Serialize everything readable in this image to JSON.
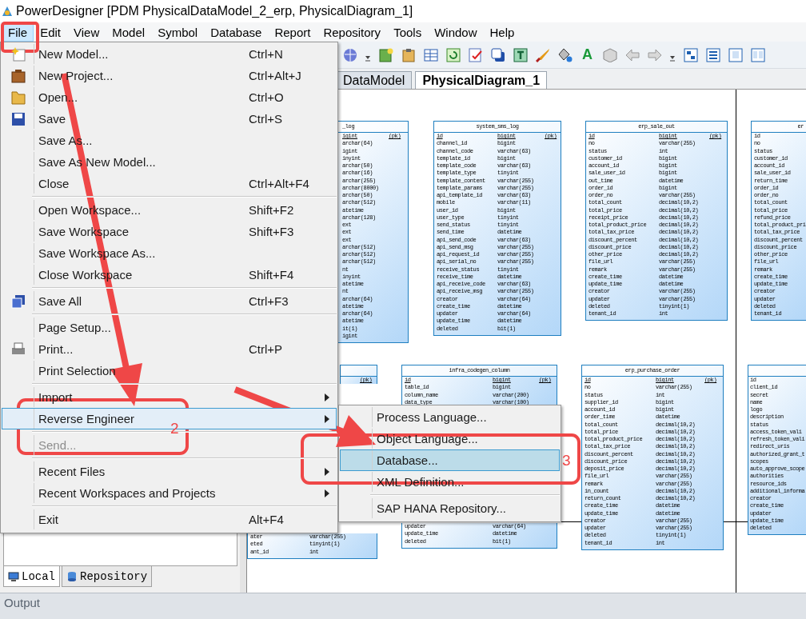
{
  "window": {
    "title": "PowerDesigner [PDM PhysicalDataModel_2_erp, PhysicalDiagram_1]"
  },
  "menubar": [
    {
      "label": "File",
      "selected": true
    },
    {
      "label": "Edit",
      "selected": false
    },
    {
      "label": "View",
      "selected": false
    },
    {
      "label": "Model",
      "selected": false
    },
    {
      "label": "Symbol",
      "selected": false
    },
    {
      "label": "Database",
      "selected": false
    },
    {
      "label": "Report",
      "selected": false
    },
    {
      "label": "Repository",
      "selected": false
    },
    {
      "label": "Tools",
      "selected": false
    },
    {
      "label": "Window",
      "selected": false
    },
    {
      "label": "Help",
      "selected": false
    }
  ],
  "toolbar": {
    "letter_icon": "A"
  },
  "diagram_tabs": [
    {
      "label": "DataModel",
      "selected": false
    },
    {
      "label": "PhysicalDiagram_1",
      "selected": true
    }
  ],
  "diagram": {
    "tables": [
      {
        "title": "_log",
        "columns": [
          {
            "type": "igint",
            "key": "(pk)"
          },
          {
            "type": "archar(64)"
          },
          {
            "type": "igint"
          },
          {
            "type": "inyint"
          },
          {
            "type": "archar(50)"
          },
          {
            "type": "archar(16)"
          },
          {
            "type": "archar(255)"
          },
          {
            "type": "archar(8000)"
          },
          {
            "type": "archar(50)"
          },
          {
            "type": "archar(512)"
          },
          {
            "type": "atetime"
          },
          {
            "type": "archar(128)"
          },
          {
            "type": "ext"
          },
          {
            "type": "ext"
          },
          {
            "type": "ext"
          },
          {
            "type": "archar(512)"
          },
          {
            "type": "archar(512)"
          },
          {
            "type": "archar(512)"
          },
          {
            "type": "nt"
          },
          {
            "type": "inyint"
          },
          {
            "type": "atetime"
          },
          {
            "type": "nt"
          },
          {
            "type": "archar(64)"
          },
          {
            "type": "atetime"
          },
          {
            "type": "archar(64)"
          },
          {
            "type": "atetime"
          },
          {
            "type": "it(1)"
          },
          {
            "type": "igint"
          }
        ]
      },
      {
        "title": "system_sms_log",
        "columns": [
          {
            "name": "id",
            "type": "bigint",
            "key": "(pk)"
          },
          {
            "name": "channel_id",
            "type": "bigint"
          },
          {
            "name": "channel_code",
            "type": "varchar(63)"
          },
          {
            "name": "template_id",
            "type": "bigint"
          },
          {
            "name": "template_code",
            "type": "varchar(63)"
          },
          {
            "name": "template_type",
            "type": "tinyint"
          },
          {
            "name": "template_content",
            "type": "varchar(255)"
          },
          {
            "name": "template_params",
            "type": "varchar(255)"
          },
          {
            "name": "api_template_id",
            "type": "varchar(63)"
          },
          {
            "name": "mobile",
            "type": "varchar(11)"
          },
          {
            "name": "user_id",
            "type": "bigint"
          },
          {
            "name": "user_type",
            "type": "tinyint"
          },
          {
            "name": "send_status",
            "type": "tinyint"
          },
          {
            "name": "send_time",
            "type": "datetime"
          },
          {
            "name": "api_send_code",
            "type": "varchar(63)"
          },
          {
            "name": "api_send_msg",
            "type": "varchar(255)"
          },
          {
            "name": "api_request_id",
            "type": "varchar(255)"
          },
          {
            "name": "api_serial_no",
            "type": "varchar(255)"
          },
          {
            "name": "receive_status",
            "type": "tinyint"
          },
          {
            "name": "receive_time",
            "type": "datetime"
          },
          {
            "name": "api_receive_code",
            "type": "varchar(63)"
          },
          {
            "name": "api_receive_msg",
            "type": "varchar(255)"
          },
          {
            "name": "creator",
            "type": "varchar(64)"
          },
          {
            "name": "create_time",
            "type": "datetime"
          },
          {
            "name": "updater",
            "type": "varchar(64)"
          },
          {
            "name": "update_time",
            "type": "datetime"
          },
          {
            "name": "deleted",
            "type": "bit(1)"
          }
        ]
      },
      {
        "title": "erp_sale_out",
        "columns": [
          {
            "name": "id",
            "type": "bigint",
            "key": "(pk)"
          },
          {
            "name": "no",
            "type": "varchar(255)"
          },
          {
            "name": "status",
            "type": "int"
          },
          {
            "name": "customer_id",
            "type": "bigint"
          },
          {
            "name": "account_id",
            "type": "bigint"
          },
          {
            "name": "sale_user_id",
            "type": "bigint"
          },
          {
            "name": "out_time",
            "type": "datetime"
          },
          {
            "name": "order_id",
            "type": "bigint"
          },
          {
            "name": "order_no",
            "type": "varchar(255)"
          },
          {
            "name": "total_count",
            "type": "decimal(10,2)"
          },
          {
            "name": "total_price",
            "type": "decimal(10,2)"
          },
          {
            "name": "receipt_price",
            "type": "decimal(10,2)"
          },
          {
            "name": "total_product_price",
            "type": "decimal(10,2)"
          },
          {
            "name": "total_tax_price",
            "type": "decimal(10,2)"
          },
          {
            "name": "discount_percent",
            "type": "decimal(10,2)"
          },
          {
            "name": "discount_price",
            "type": "decimal(10,2)"
          },
          {
            "name": "other_price",
            "type": "decimal(10,2)"
          },
          {
            "name": "file_url",
            "type": "varchar(255)"
          },
          {
            "name": "remark",
            "type": "varchar(255)"
          },
          {
            "name": "create_time",
            "type": "datetime"
          },
          {
            "name": "update_time",
            "type": "datetime"
          },
          {
            "name": "creator",
            "type": "varchar(255)"
          },
          {
            "name": "updater",
            "type": "varchar(255)"
          },
          {
            "name": "deleted",
            "type": "tinyint(1)"
          },
          {
            "name": "tenant_id",
            "type": "int"
          }
        ]
      },
      {
        "title": "er",
        "columns": [
          {
            "name": "id"
          },
          {
            "name": "no"
          },
          {
            "name": "status"
          },
          {
            "name": "customer_id"
          },
          {
            "name": "account_id"
          },
          {
            "name": "sale_user_id"
          },
          {
            "name": "return_time"
          },
          {
            "name": "order_id"
          },
          {
            "name": "order_no"
          },
          {
            "name": "total_count"
          },
          {
            "name": "total_price"
          },
          {
            "name": "refund_price"
          },
          {
            "name": "total_product_pri"
          },
          {
            "name": "total_tax_price"
          },
          {
            "name": "discount_percent"
          },
          {
            "name": "discount_price"
          },
          {
            "name": "other_price"
          },
          {
            "name": "file_url"
          },
          {
            "name": "remark"
          },
          {
            "name": "create_time"
          },
          {
            "name": "update_time"
          },
          {
            "name": "creator"
          },
          {
            "name": "updater"
          },
          {
            "name": "deleted"
          },
          {
            "name": "tenant_id"
          }
        ]
      },
      {
        "columns": [
          {
            "key": "(pk)"
          }
        ],
        "columns_below_menu": [
          {
            "name": "ater",
            "type": "varchar(255)"
          },
          {
            "name": "eted",
            "type": "tinyint(1)"
          },
          {
            "name": "ant_id",
            "type": "int"
          }
        ]
      },
      {
        "title": "infra_codegen_column",
        "columns": [
          {
            "name": "id",
            "type": "bigint",
            "key": "(pk)"
          },
          {
            "name": "table_id",
            "type": "bigint"
          },
          {
            "name": "column_name",
            "type": "varchar(200)"
          },
          {
            "name": "data_type",
            "type": "varchar(100)"
          }
        ],
        "columns_below_menu": [
          {
            "name": "updater",
            "type": "varchar(64)"
          },
          {
            "name": "update_time",
            "type": "datetime"
          },
          {
            "name": "deleted",
            "type": "bit(1)"
          }
        ]
      },
      {
        "title": "erp_purchase_order",
        "columns": [
          {
            "name": "id",
            "type": "bigint",
            "key": "(pk)"
          },
          {
            "name": "no",
            "type": "varchar(255)"
          },
          {
            "name": "status",
            "type": "int"
          },
          {
            "name": "supplier_id",
            "type": "bigint"
          },
          {
            "name": "account_id",
            "type": "bigint"
          },
          {
            "name": "order_time",
            "type": "datetime"
          },
          {
            "name": "total_count",
            "type": "decimal(10,2)"
          },
          {
            "name": "total_price",
            "type": "decimal(10,2)"
          },
          {
            "name": "total_product_price",
            "type": "decimal(10,2)"
          },
          {
            "name": "total_tax_price",
            "type": "decimal(10,2)"
          },
          {
            "name": "discount_percent",
            "type": "decimal(10,2)"
          },
          {
            "name": "discount_price",
            "type": "decimal(10,2)"
          },
          {
            "name": "deposit_price",
            "type": "decimal(10,2)"
          },
          {
            "name": "file_url",
            "type": "varchar(255)"
          },
          {
            "name": "remark",
            "type": "varchar(255)"
          },
          {
            "name": "in_count",
            "type": "decimal(10,2)"
          },
          {
            "name": "return_count",
            "type": "decimal(10,2)"
          },
          {
            "name": "create_time",
            "type": "datetime"
          },
          {
            "name": "update_time",
            "type": "datetime"
          },
          {
            "name": "creator",
            "type": "varchar(255)"
          },
          {
            "name": "updater",
            "type": "varchar(255)"
          },
          {
            "name": "deleted",
            "type": "tinyint(1)"
          },
          {
            "name": "tenant_id",
            "type": "int"
          }
        ]
      },
      {
        "columns": [
          {
            "name": "id"
          },
          {
            "name": "client_id"
          },
          {
            "name": "secret"
          },
          {
            "name": "name"
          },
          {
            "name": "logo"
          },
          {
            "name": "description"
          },
          {
            "name": "status"
          },
          {
            "name": "access_token_vali"
          },
          {
            "name": "refresh_token_vali"
          },
          {
            "name": "redirect_uris"
          },
          {
            "name": "authorized_grant_t"
          },
          {
            "name": "scopes"
          },
          {
            "name": "auto_approve_scope"
          },
          {
            "name": "authorities"
          },
          {
            "name": "resource_ids"
          },
          {
            "name": "additional_informa"
          },
          {
            "name": "creator"
          },
          {
            "name": "create_time"
          },
          {
            "name": "updater"
          },
          {
            "name": "update_time"
          },
          {
            "name": "deleted"
          }
        ]
      }
    ]
  },
  "file_menu": [
    {
      "kind": "item",
      "label": "New Model...",
      "shortcut": "Ctrl+N",
      "disabled": false,
      "submenu": false,
      "selected": false
    },
    {
      "kind": "item",
      "label": "New Project...",
      "shortcut": "Ctrl+Alt+J",
      "disabled": false,
      "submenu": false,
      "selected": false
    },
    {
      "kind": "item",
      "label": "Open...",
      "shortcut": "Ctrl+O",
      "disabled": false,
      "submenu": false,
      "selected": false
    },
    {
      "kind": "item",
      "label": "Save",
      "shortcut": "Ctrl+S",
      "disabled": false,
      "submenu": false,
      "selected": false
    },
    {
      "kind": "item",
      "label": "Save As...",
      "disabled": false,
      "submenu": false,
      "selected": false
    },
    {
      "kind": "item",
      "label": "Save As New Model...",
      "disabled": false,
      "submenu": false,
      "selected": false
    },
    {
      "kind": "item",
      "label": "Close",
      "shortcut": "Ctrl+Alt+F4",
      "disabled": false,
      "submenu": false,
      "selected": false
    },
    {
      "kind": "separator"
    },
    {
      "kind": "item",
      "label": "Open Workspace...",
      "shortcut": "Shift+F2",
      "disabled": false,
      "submenu": false,
      "selected": false
    },
    {
      "kind": "item",
      "label": "Save Workspace",
      "shortcut": "Shift+F3",
      "disabled": false,
      "submenu": false,
      "selected": false
    },
    {
      "kind": "item",
      "label": "Save Workspace As...",
      "disabled": false,
      "submenu": false,
      "selected": false
    },
    {
      "kind": "item",
      "label": "Close Workspace",
      "shortcut": "Shift+F4",
      "disabled": false,
      "submenu": false,
      "selected": false
    },
    {
      "kind": "separator"
    },
    {
      "kind": "item",
      "label": "Save All",
      "shortcut": "Ctrl+F3",
      "disabled": false,
      "submenu": false,
      "selected": false
    },
    {
      "kind": "separator"
    },
    {
      "kind": "item",
      "label": "Page Setup...",
      "disabled": false,
      "submenu": false,
      "selected": false
    },
    {
      "kind": "item",
      "label": "Print...",
      "shortcut": "Ctrl+P",
      "disabled": false,
      "submenu": false,
      "selected": false
    },
    {
      "kind": "item",
      "label": "Print Selection",
      "disabled": false,
      "submenu": false,
      "selected": false
    },
    {
      "kind": "separator"
    },
    {
      "kind": "item",
      "label": "Import",
      "disabled": false,
      "submenu": true,
      "selected": false
    },
    {
      "kind": "item",
      "label": "Reverse Engineer",
      "disabled": false,
      "submenu": true,
      "selected": true
    },
    {
      "kind": "separator"
    },
    {
      "kind": "item",
      "label": "Send...",
      "disabled": true,
      "submenu": false,
      "selected": false
    },
    {
      "kind": "separator"
    },
    {
      "kind": "item",
      "label": "Recent Files",
      "disabled": false,
      "submenu": true,
      "selected": false
    },
    {
      "kind": "item",
      "label": "Recent Workspaces and Projects",
      "disabled": false,
      "submenu": true,
      "selected": false
    },
    {
      "kind": "separator"
    },
    {
      "kind": "item",
      "label": "Exit",
      "shortcut": "Alt+F4",
      "disabled": false,
      "submenu": false,
      "selected": false
    }
  ],
  "reverse_engineer_submenu": [
    {
      "kind": "item",
      "label": "Process Language...",
      "selected": false
    },
    {
      "kind": "item",
      "label": "Object Language...",
      "selected": false
    },
    {
      "kind": "item",
      "label": "Database...",
      "selected": true
    },
    {
      "kind": "item",
      "label": "XML Definition...",
      "selected": false
    },
    {
      "kind": "separator"
    },
    {
      "kind": "item",
      "label": "SAP HANA Repository...",
      "selected": false
    }
  ],
  "browser_tabs": [
    {
      "label": "Local",
      "selected": true
    },
    {
      "label": "Repository",
      "selected": false
    }
  ],
  "output_panel": {
    "title": "Output"
  },
  "annotations": [
    "2",
    "3"
  ]
}
